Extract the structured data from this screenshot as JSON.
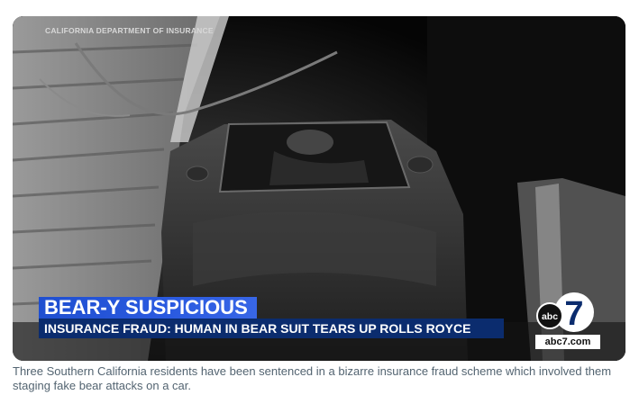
{
  "media": {
    "watermark": "CALIFORNIA DEPARTMENT OF INSURANCE",
    "headline": "BEAR-Y SUSPICIOUS",
    "subheadline": "INSURANCE FRAUD: HUMAN IN BEAR SUIT TEARS UP ROLLS ROYCE",
    "logo": {
      "icon": "abc7-logo-icon",
      "abc_text": "abc",
      "channel_number": "7",
      "url_text": "abc7.com"
    }
  },
  "caption": "Three Southern California residents have been sentenced in a bizarre insurance fraud scheme which involved them staging fake bear attacks on a car.",
  "colors": {
    "headline_bar": "#2a5ae0",
    "subhead_bar": "#0b2c6e",
    "caption_text": "#536471"
  }
}
